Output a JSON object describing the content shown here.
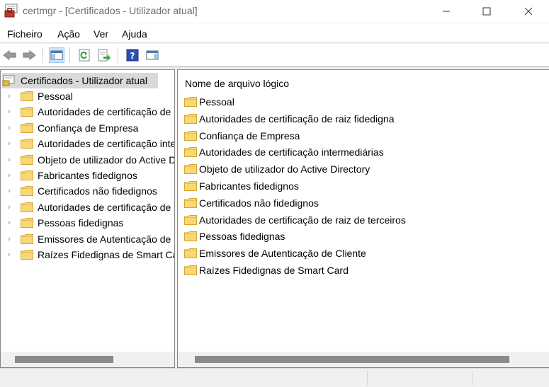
{
  "window": {
    "title": "certmgr - [Certificados - Utilizador atual]",
    "controls": [
      "minimize",
      "maximize",
      "close"
    ]
  },
  "menu": {
    "items": [
      "Ficheiro",
      "Ação",
      "Ver",
      "Ajuda"
    ]
  },
  "toolbar": {
    "buttons": [
      {
        "icon": "back-arrow-icon"
      },
      {
        "icon": "forward-arrow-icon"
      },
      {
        "icon": "show-hide-console-tree-icon",
        "active": true
      },
      {
        "icon": "refresh-icon"
      },
      {
        "icon": "export-list-icon"
      },
      {
        "icon": "help-icon"
      },
      {
        "icon": "show-hide-action-pane-icon"
      }
    ]
  },
  "tree": {
    "root": "Certificados - Utilizador atual",
    "items": [
      "Pessoal",
      "Autoridades de certificação de raiz fidedigna",
      "Confiança de Empresa",
      "Autoridades de certificação intermediárias",
      "Objeto de utilizador do Active Directory",
      "Fabricantes fidedignos",
      "Certificados não fidedignos",
      "Autoridades de certificação de raiz de terceiros",
      "Pessoas fidedignas",
      "Emissores de Autenticação de Cliente",
      "Raízes Fidedignas de Smart Card"
    ]
  },
  "list": {
    "column_header": "Nome de arquivo lógico",
    "items": [
      "Pessoal",
      "Autoridades de certificação de raiz fidedigna",
      "Confiança de Empresa",
      "Autoridades de certificação intermediárias",
      "Objeto de utilizador do Active Directory",
      "Fabricantes fidedignos",
      "Certificados não fidedignos",
      "Autoridades de certificação de raiz de terceiros",
      "Pessoas fidedignas",
      "Emissores de Autenticação de Cliente",
      "Raízes Fidedignas de Smart Card"
    ]
  },
  "colors": {
    "folder": "#f8d775",
    "folder_edge": "#d9a62e",
    "selection": "#d9d9d9",
    "help": "#2b4fb3"
  }
}
